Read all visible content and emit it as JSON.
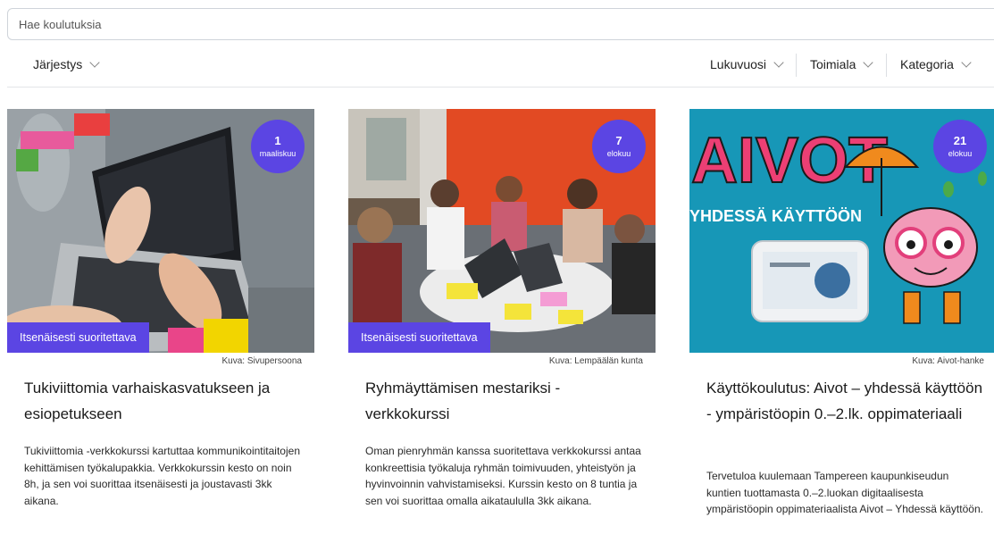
{
  "search": {
    "placeholder": "Hae koulutuksia"
  },
  "filters": {
    "sort": {
      "label": "Järjestys",
      "icon": "chevron-down-icon"
    },
    "year": {
      "label": "Lukuvuosi",
      "icon": "chevron-down-icon"
    },
    "field": {
      "label": "Toimiala",
      "icon": "chevron-down-icon"
    },
    "category": {
      "label": "Kategoria",
      "icon": "chevron-down-icon"
    }
  },
  "colors": {
    "accent": "#5b45e3",
    "divider": "#e3e5e8"
  },
  "cards": [
    {
      "date_day": "1",
      "date_month": "maaliskuu",
      "tag": "Itsenäisesti suoritettava",
      "credit": "Kuva: Sivupersoona",
      "title": "Tukiviittomia varhaiskasvatukseen ja esiopetukseen",
      "description": "Tukiviittomia -verkkokurssi kartuttaa kommunikointitaitojen kehittämisen työkalupakkia. Verkkokurssin kesto on noin 8h, ja sen voi suorittaa itsenäisesti ja joustavasti 3kk aikana."
    },
    {
      "date_day": "7",
      "date_month": "elokuu",
      "tag": "Itsenäisesti suoritettava",
      "credit": "Kuva: Lempäälän kunta",
      "title": "Ryhmäyttämisen mestariksi - verkkokurssi",
      "description": "Oman pienryhmän kanssa suoritettava verkkokurssi antaa konkreettisia työkaluja ryhmän toimivuuden, yhteistyön ja hyvinvoinnin vahvistamiseksi. Kurssin kesto on 8 tuntia ja sen voi suorittaa omalla aikataululla 3kk aikana."
    },
    {
      "date_day": "21",
      "date_month": "elokuu",
      "image_text_main": "AIVOT",
      "image_text_sub": "YHDESSÄ KÄYTTÖÖN",
      "credit": "Kuva: Aivot-hanke",
      "title": "Käyttökoulutus: Aivot – yhdessä käyttöön - ympäristöopin 0.–2.lk. oppimateriaali",
      "description": "Tervetuloa kuulemaan Tampereen kaupunkiseudun kuntien tuottamasta 0.–2.luokan digitaalisesta ympäristöopin oppimateriaalista Aivot – Yhdessä käyttöön."
    }
  ]
}
